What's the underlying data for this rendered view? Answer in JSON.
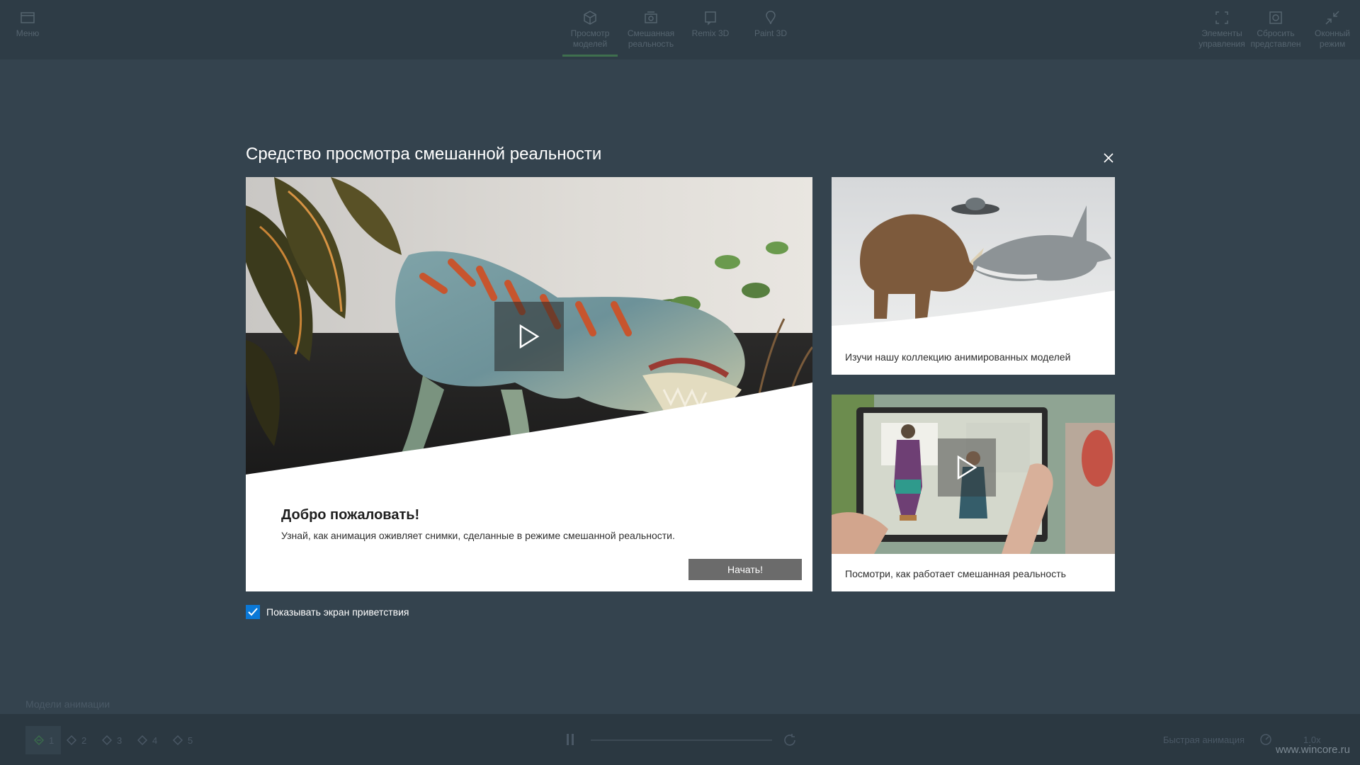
{
  "topbar": {
    "menu_label": "Меню",
    "tabs": [
      {
        "label_line1": "Просмотр",
        "label_line2": "моделей",
        "icon": "cube-icon",
        "active": true
      },
      {
        "label_line1": "Смешанная",
        "label_line2": "реальность",
        "icon": "mixed-reality-icon",
        "active": false
      },
      {
        "label_line1": "Remix 3D",
        "label_line2": "",
        "icon": "remix-icon",
        "active": false
      },
      {
        "label_line1": "Paint 3D",
        "label_line2": "",
        "icon": "paint-icon",
        "active": false
      }
    ],
    "right_buttons": [
      {
        "label_line1": "Элементы",
        "label_line2": "управления",
        "icon": "controls-icon"
      },
      {
        "label_line1": "Сбросить",
        "label_line2": "представлен",
        "icon": "reset-view-icon"
      },
      {
        "label_line1": "Оконный",
        "label_line2": "режим",
        "icon": "windowed-mode-icon"
      }
    ]
  },
  "dialog": {
    "title": "Средство просмотра смешанной реальности",
    "close_icon": "close-icon",
    "main_card": {
      "heading": "Добро пожаловать!",
      "text": "Узнай, как анимация оживляет снимки, сделанные в режиме смешанной реальности.",
      "button_label": "Начать!"
    },
    "side_cards": [
      {
        "caption": "Изучи нашу коллекцию анимированных моделей"
      },
      {
        "caption": "Посмотри, как работает смешанная реальность"
      }
    ],
    "show_welcome": {
      "label": "Показывать экран приветствия",
      "checked": true
    }
  },
  "bottom": {
    "section_label": "Модели анимации",
    "animations": [
      "1",
      "2",
      "3",
      "4",
      "5"
    ],
    "speed_label": "Быстрая анимация",
    "speed_value": "1.0x",
    "watermark": "www.wincore.ru"
  },
  "colors": {
    "accent": "#0a78d7",
    "button_gray": "#6b6b6b",
    "background": "#34434e"
  }
}
